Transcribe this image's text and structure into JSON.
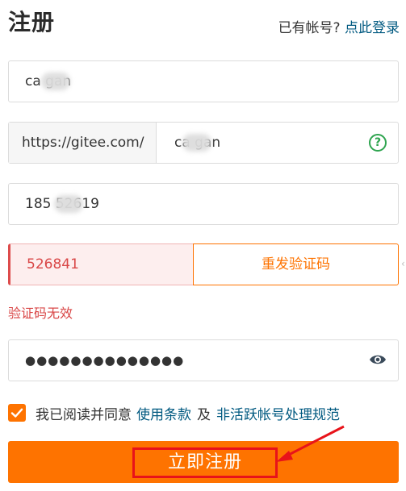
{
  "header": {
    "title": "注册",
    "login_prompt": "已有帐号?",
    "login_link": "点此登录"
  },
  "form": {
    "username_value": "ca gan",
    "url_prefix": "https://gitee.com/",
    "url_value": "ca gan",
    "phone_value": "185 52619",
    "code_value": "526841",
    "resend_label": "重发验证码",
    "code_error": "验证码无效",
    "password_mask": "●●●●●●●●●●●●●●"
  },
  "agreement": {
    "text": "我已阅读并同意",
    "terms_link": "使用条款",
    "and": "及",
    "policy_link": "非活跃帐号处理规范",
    "checked": true
  },
  "submit": {
    "label": "立即注册"
  },
  "colors": {
    "accent": "#fe7300",
    "link": "#005980",
    "error": "#d94747",
    "annotation": "#e8131a",
    "help": "#2ea44f"
  },
  "icons": [
    "help-icon",
    "eye-icon",
    "check-icon",
    "arrow-icon"
  ]
}
